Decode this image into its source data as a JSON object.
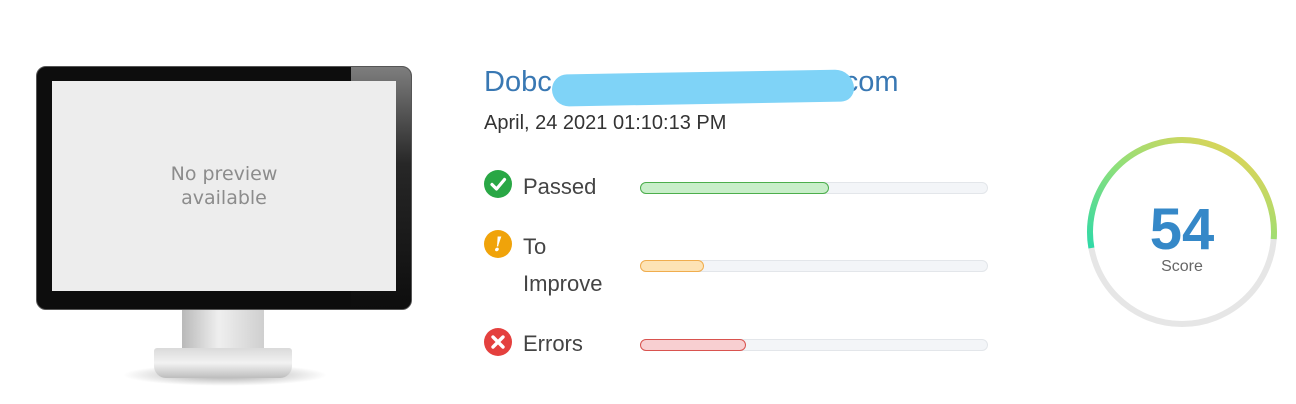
{
  "preview": {
    "text": "No preview available"
  },
  "site": {
    "title": "Dobc…com",
    "title_left": "Dobc",
    "title_right": ".com",
    "timestamp": "April, 24 2021 01:10:13 PM"
  },
  "results": [
    {
      "label": "Passed",
      "icon": "check-icon",
      "color": "#29a745",
      "fill_color": "#c8eec9",
      "border_color": "#4cae4c",
      "fraction": 0.54
    },
    {
      "label": "To Improve",
      "label_line1": "To",
      "label_line2": "Improve",
      "icon": "exclamation-icon",
      "color": "#f0a30a",
      "fill_color": "#fde3b5",
      "border_color": "#f0ad4e",
      "fraction": 0.18
    },
    {
      "label": "Errors",
      "icon": "x-icon",
      "color": "#e4403e",
      "fill_color": "#f8cfd1",
      "border_color": "#d9534f",
      "fraction": 0.3
    }
  ],
  "score": {
    "value": "54",
    "label": "Score",
    "fraction": 0.54
  }
}
